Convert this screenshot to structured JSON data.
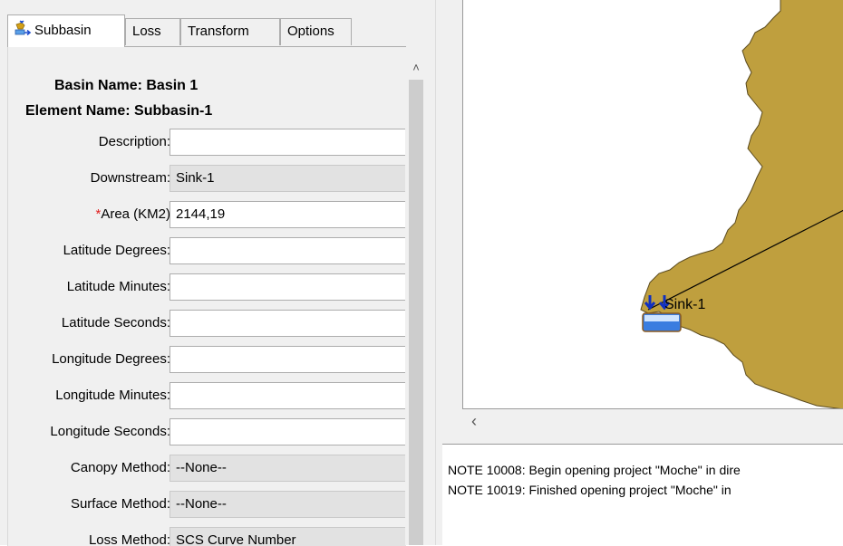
{
  "tabs": {
    "subbasin": "Subbasin",
    "loss": "Loss",
    "transform": "Transform",
    "options": "Options"
  },
  "header": {
    "basin_name": "Basin Name: Basin 1",
    "element_name": "Element Name: Subbasin-1"
  },
  "fields": {
    "description": {
      "label": "Description:",
      "value": ""
    },
    "downstream": {
      "label": "Downstream:",
      "value": "Sink-1"
    },
    "area": {
      "required_mark": "*",
      "label": "Area (KM2)",
      "value": "2144,19"
    },
    "lat_deg": {
      "label": "Latitude Degrees:",
      "value": ""
    },
    "lat_min": {
      "label": "Latitude Minutes:",
      "value": ""
    },
    "lat_sec": {
      "label": "Latitude Seconds:",
      "value": ""
    },
    "lon_deg": {
      "label": "Longitude Degrees:",
      "value": ""
    },
    "lon_min": {
      "label": "Longitude Minutes:",
      "value": ""
    },
    "lon_sec": {
      "label": "Longitude Seconds:",
      "value": ""
    },
    "canopy": {
      "label": "Canopy Method:",
      "value": "--None--"
    },
    "surface": {
      "label": "Surface Method:",
      "value": "--None--"
    },
    "loss": {
      "label": "Loss Method:",
      "value": "SCS Curve Number"
    }
  },
  "map": {
    "sink_label": "Sink-1",
    "basin_color": "#bf9f3e"
  },
  "log": {
    "line1": "NOTE 10008:  Begin opening project \"Moche\" in dire",
    "line2": "NOTE 10019:  Finished opening project \"Moche\" in"
  },
  "icons": {
    "subbasin_tab": "subbasin-icon",
    "scroll_up": "chevron-up-icon",
    "scroll_left": "chevron-left-icon",
    "sink": "sink-icon"
  }
}
